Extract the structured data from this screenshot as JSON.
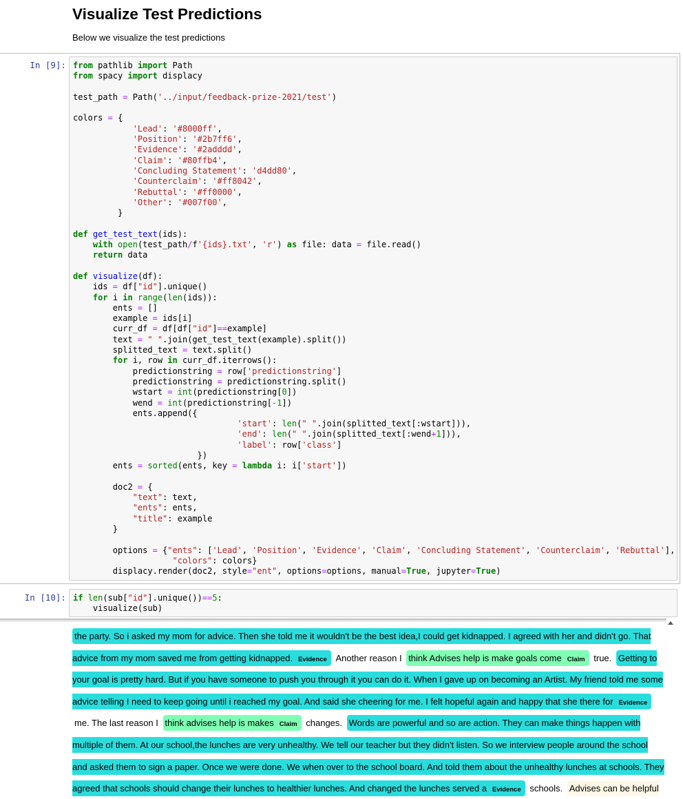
{
  "markdown": {
    "heading": "Visualize Test Predictions",
    "text": "Below we visualize the test predictions"
  },
  "cells": [
    {
      "prompt": "In [9]:"
    },
    {
      "prompt": "In [10]:"
    }
  ],
  "entity_colors": {
    "Evidence": "#2adddd",
    "Claim": "#80ffb4",
    "Other": "#fff8e7"
  },
  "output": {
    "spans": [
      {
        "text": "the party. So i asked my mom for advice. Then she told me it wouldn't be the best idea,I could get kidnapped. I agreed with her and didn't go. That advice from my mom saved me from getting kidnapped.",
        "label": "Evidence"
      },
      {
        "text": "Another reason I"
      },
      {
        "text": "think Advises help is make goals come",
        "label": "Claim"
      },
      {
        "text": "true."
      },
      {
        "text": "Getting to your goal is pretty hard. But if you have someone to push you through it you can do it. When I gave up on becoming an Artist. My friend told me some advice telling I need to keep going until i reached my goal. And said she cheering for me. I felt hopeful again and happy that she there for",
        "label": "Evidence"
      },
      {
        "text": "me. The last reason I"
      },
      {
        "text": "think advises help is makes",
        "label": "Claim"
      },
      {
        "text": "changes."
      },
      {
        "text": "Words are powerful and so are action. They can make things happen with multiple of them. At our school,the lunches are very unhealthy. We tell our teacher but they didn't listen. So we interview people around the school and asked them to sign a paper. Once we were done. We when over to the school board. And told them about the unhealthy lunches at schools. They agreed that schools should change their lunches to healthier lunches. And changed the lunches served a",
        "label": "Evidence"
      },
      {
        "text": "schools."
      },
      {
        "text": "Advises can be helpful or not helpful. But if it",
        "label": "Other"
      }
    ]
  }
}
